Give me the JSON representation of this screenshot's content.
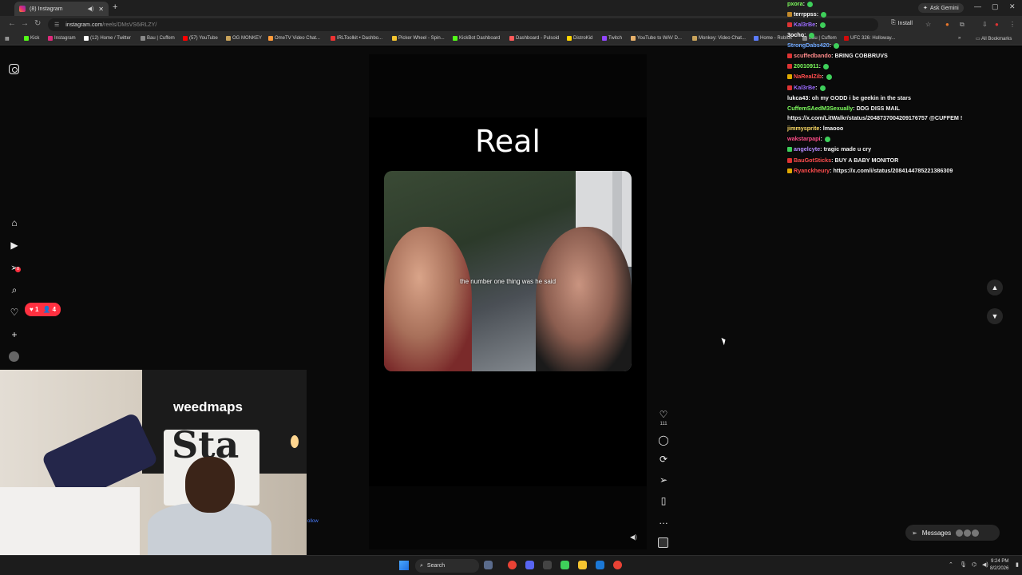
{
  "browser": {
    "tab_title": "(8) Instagram",
    "new_tab": "+",
    "url_host": "instagram.com",
    "url_path": "/reels/DMsVS6iRLZY/",
    "ask_gemini": "Ask Gemini",
    "install": "Install",
    "bookmarks": [
      "Kick",
      "Instagram",
      "(12) Home / Twitter",
      "Bau | Cuffem",
      "(57) YouTube",
      "OG MONKEY",
      "OmeTV Video Chat...",
      "IRLToolkit • Dashbo...",
      "Picker Wheel - Spin...",
      "KickBot Dashboard",
      "Dashboard - Pulsoid",
      "DistroKid",
      "Twitch",
      "YouTube to WAV D...",
      "Monkey: Video Chat...",
      "Home - Roblox",
      "Bau | Cuffem",
      "UFC 326: Holloway..."
    ],
    "all_bookmarks": "All Bookmarks",
    "accent": "#ff3040"
  },
  "instagram": {
    "notif_likes": "1",
    "notif_follows": "4",
    "notif_badge": "8",
    "reel_title": "Real",
    "subtitle": "the number one thing was he said",
    "like_count": "111",
    "follow_text": "ollow",
    "messages_label": "Messages"
  },
  "webcam": {
    "banner_text": "weedmaps",
    "board_text": "Sta"
  },
  "chat": [
    {
      "user": "pxora",
      "color": "#7fff5e",
      "badge": "",
      "text": ""
    },
    {
      "user": "terrppss",
      "color": "#ffffff",
      "badge": "#c2892b",
      "text": ""
    },
    {
      "user": "Kal3rBe",
      "color": "#9b6bff",
      "badge": "#d33",
      "text": ""
    },
    {
      "user": "3ocho",
      "color": "#ffffff",
      "badge": "",
      "text": ""
    },
    {
      "user": "StrongDabs420",
      "color": "#6fa8ff",
      "badge": "",
      "text": ""
    },
    {
      "user": "scuffedbando",
      "color": "#ff8a8a",
      "badge": "#d33",
      "text": "BRING COBBRUVS"
    },
    {
      "user": "20010911",
      "color": "#7fff5e",
      "badge": "#d33",
      "text": ""
    },
    {
      "user": "NaRealZib",
      "color": "#ff4d4d",
      "badge": "#e0a800",
      "text": ""
    },
    {
      "user": "Kal3rBe",
      "color": "#9b6bff",
      "badge": "#d33",
      "text": ""
    },
    {
      "user": "lukca43",
      "color": "#ffffff",
      "badge": "",
      "text": "oh my GODD i be geekin in the stars"
    },
    {
      "user": "CuffemSAedM3Sexually",
      "color": "#7fff5e",
      "badge": "",
      "text": "DDG DISS MAIL"
    },
    {
      "user": "",
      "color": "#ffffff",
      "badge": "",
      "text": "https://x.com/LitWalkr/status/2048737004209176757 @CUFFEM !"
    },
    {
      "user": "jimmysprite",
      "color": "#ffdd66",
      "badge": "",
      "text": "lmaooo"
    },
    {
      "user": "wakstarpapi",
      "color": "#ff4d88",
      "badge": "",
      "text": ""
    },
    {
      "user": "angelcyte",
      "color": "#b48cff",
      "badge": "#3ecf5a",
      "text": "tragic made u cry"
    },
    {
      "user": "BauGotSticks",
      "color": "#ff4d4d",
      "badge": "#d33",
      "text": "BUY A BABY MONITOR"
    },
    {
      "user": "Ryanckheury",
      "color": "#ff4d4d",
      "badge": "#e0a800",
      "text": "https://x.com/i/status/2084144785221386309"
    }
  ],
  "taskbar": {
    "search_label": "Search",
    "time": "9:24 PM",
    "date": "8/2/2026"
  }
}
